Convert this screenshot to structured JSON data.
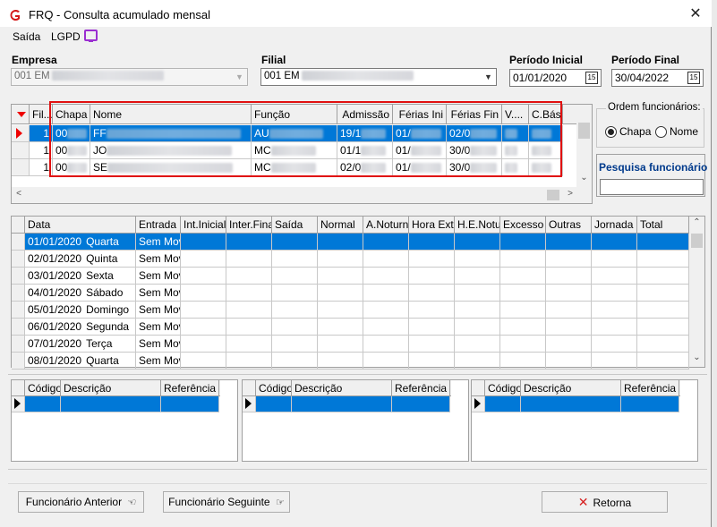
{
  "window": {
    "title": "FRQ - Consulta acumulado mensal"
  },
  "menu": [
    {
      "label": "Saída"
    },
    {
      "label": "LGPD"
    }
  ],
  "filters": {
    "empresa_label": "Empresa",
    "empresa_value": "001 EM",
    "filial_label": "Filial",
    "filial_value": "001 EM",
    "periodo_inicial_label": "Período Inicial",
    "periodo_inicial_value": "01/01/2020",
    "periodo_final_label": "Período Final",
    "periodo_final_value": "30/04/2022",
    "cal_glyph": "15"
  },
  "employees": {
    "columns": [
      "Fil...",
      "Chapa",
      "Nome",
      "Função",
      "Admissão",
      "Férias Ini",
      "Férias Fin",
      "V....",
      "C.Bás"
    ],
    "rows": [
      {
        "fil": "1",
        "chapa": "00",
        "nome": "FF",
        "funcao": "AU",
        "admissao": "19/1",
        "ferias_ini": "01/",
        "ferias_fin": "02/0"
      },
      {
        "fil": "1",
        "chapa": "00",
        "nome": "JO",
        "funcao": "MC",
        "admissao": "01/1",
        "ferias_ini": "01/",
        "ferias_fin": "30/0"
      },
      {
        "fil": "1",
        "chapa": "00",
        "nome": "SE",
        "funcao": "MC",
        "admissao": "02/0",
        "ferias_ini": "01/",
        "ferias_fin": "30/0"
      }
    ]
  },
  "order": {
    "title": "Ordem funcionários:",
    "options": [
      {
        "label": "Chapa",
        "checked": true
      },
      {
        "label": "Nome",
        "checked": false
      }
    ]
  },
  "search": {
    "title": "Pesquisa funcionário"
  },
  "days": {
    "columns": [
      "Data",
      "Entrada",
      "Int.Inicial",
      "Inter.Final",
      "Saída",
      "Normal",
      "A.Noturn",
      "Hora Extr",
      "H.E.Notu",
      "Excesso",
      "Outras",
      "Jornada",
      "Total"
    ],
    "rows": [
      {
        "date": "01/01/2020",
        "weekday": "Quarta",
        "entrada": "Sem Mov"
      },
      {
        "date": "02/01/2020",
        "weekday": "Quinta",
        "entrada": "Sem Mov"
      },
      {
        "date": "03/01/2020",
        "weekday": "Sexta",
        "entrada": "Sem Mov"
      },
      {
        "date": "04/01/2020",
        "weekday": "Sábado",
        "entrada": "Sem Mov"
      },
      {
        "date": "05/01/2020",
        "weekday": "Domingo",
        "entrada": "Sem Mov"
      },
      {
        "date": "06/01/2020",
        "weekday": "Segunda",
        "entrada": "Sem Mov"
      },
      {
        "date": "07/01/2020",
        "weekday": "Terça",
        "entrada": "Sem Mov"
      },
      {
        "date": "08/01/2020",
        "weekday": "Quarta",
        "entrada": "Sem Mov"
      }
    ]
  },
  "detail_grids": [
    {
      "columns": [
        "Código",
        "Descrição",
        "Referência"
      ]
    },
    {
      "columns": [
        "Código",
        "Descrição",
        "Referência"
      ]
    },
    {
      "columns": [
        "Código",
        "Descrição",
        "Referência"
      ]
    }
  ],
  "buttons": {
    "prev_employee": "Funcionário Anterior",
    "next_employee": "Funcionário Seguinte",
    "back": "Retorna"
  },
  "colors": {
    "selection": "#0078d7",
    "highlight": "#e01010",
    "accent_purple": "#9b2fd1"
  }
}
